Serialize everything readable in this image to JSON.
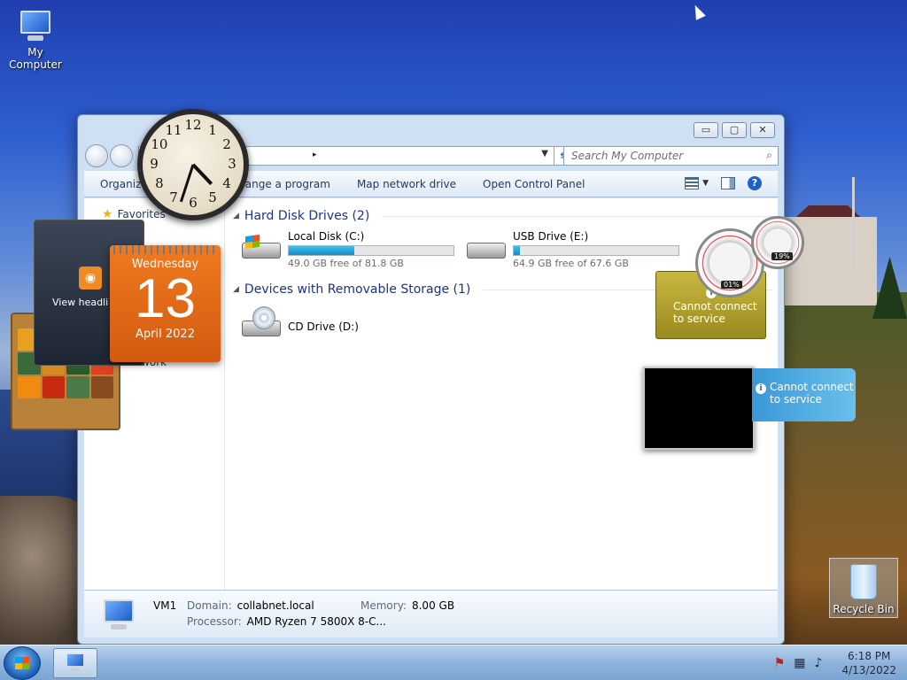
{
  "desktop": {
    "icons": [
      {
        "label": "My Computer"
      },
      {
        "label": "Recycle Bin"
      }
    ]
  },
  "window": {
    "controls": {
      "minimize": "▭",
      "maximize": "▢",
      "close": "✕"
    },
    "address": {
      "chevron": "▸"
    },
    "search": {
      "placeholder": "Search My Computer"
    },
    "toolbar": {
      "organize": "Organize",
      "uninstall": "ange a program",
      "map_drive": "Map network drive",
      "control_panel": "Open Control Panel"
    },
    "nav": {
      "favorites": "Favorites",
      "network": "etwork"
    },
    "groups": {
      "hard_disk": "Hard Disk Drives (2)",
      "removable": "Devices with Removable Storage (1)"
    },
    "drives": [
      {
        "name": "Local Disk (C:)",
        "free_text": "49.0 GB free of 81.8 GB",
        "used_fraction": 0.4
      },
      {
        "name": "USB Drive (E:)",
        "free_text": "64.9 GB free of 67.6 GB",
        "used_fraction": 0.04
      },
      {
        "name": "CD Drive (D:)"
      }
    ],
    "details": {
      "name": "VM1",
      "domain_label": "Domain:",
      "domain": "collabnet.local",
      "memory_label": "Memory:",
      "memory": "8.00 GB",
      "processor_label": "Processor:",
      "processor": "AMD Ryzen 7 5800X 8-C..."
    }
  },
  "gadgets": {
    "clock": {
      "time": "4:33",
      "numerals": [
        "12",
        "1",
        "2",
        "3",
        "4",
        "5",
        "6",
        "7",
        "8",
        "9",
        "10",
        "11"
      ]
    },
    "calendar": {
      "weekday": "Wednesday",
      "day": "13",
      "month_year": "April 2022"
    },
    "feed": {
      "text": "View headli"
    },
    "cpu_meter": {
      "cpu": "01%",
      "memory": "19%"
    },
    "weather": {
      "message": "Cannot connect to service"
    },
    "slideshow": {
      "message": "Cannot connect to service"
    }
  },
  "taskbar": {
    "time": "6:18 PM",
    "date": "4/13/2022"
  },
  "colors": {
    "drive_bar": "#1a8ac4",
    "calendar": "#e06a18",
    "link_text": "#1e395b"
  }
}
